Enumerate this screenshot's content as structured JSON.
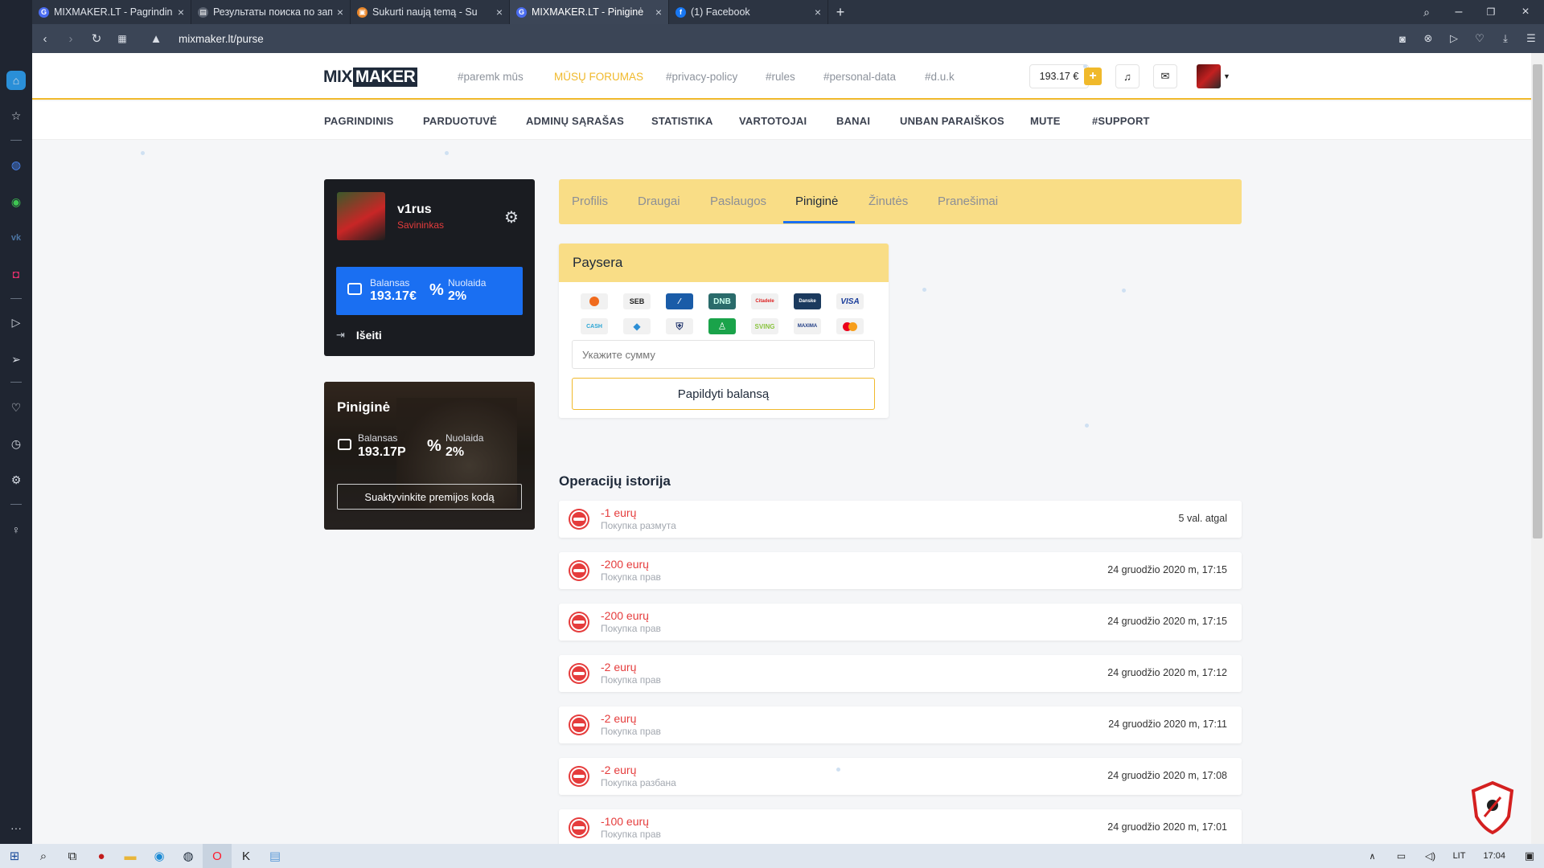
{
  "browser": {
    "tabs": [
      {
        "title": "MIXMAKER.LT - Pagrindinis",
        "favicon": "G",
        "fav_color": "#4a6cf0"
      },
      {
        "title": "Результаты поиска по зап",
        "favicon": "▤",
        "fav_color": "#5a6270"
      },
      {
        "title": "Sukurti naują temą - Su",
        "favicon": "▣",
        "fav_color": "#e8862a"
      },
      {
        "title": "MIXMAKER.LT - Piniginė",
        "favicon": "G",
        "fav_color": "#4a6cf0"
      },
      {
        "title": "(1) Facebook",
        "favicon": "f",
        "fav_color": "#1877f2"
      }
    ],
    "new_tab": "+",
    "address": "mixmaker.lt/purse"
  },
  "site": {
    "logo_mix": "MIX",
    "logo_maker": "MAKER",
    "top_links": [
      "#paremk mūs",
      "MŪSŲ FORUMAS",
      "#privacy-policy",
      "#rules",
      "#personal-data",
      "#d.u.k"
    ],
    "balance_pill": "193.17 €",
    "add_btn": "+",
    "menu": [
      "PAGRINDINIS",
      "PARDUOTUVĖ",
      "ADMINŲ SĄRAŠAS",
      "STATISTIKA",
      "VARTOTOJAI",
      "BANAI",
      "UNBAN PARAIŠKOS",
      "MUTE",
      "#SUPPORT"
    ]
  },
  "profile": {
    "name": "v1rus",
    "role": "Savininkas",
    "balance_label": "Balansas",
    "balance": "193.17€",
    "discount_label": "Nuolaida",
    "discount": "2%",
    "logout": "Išeiti"
  },
  "wallet": {
    "title": "Piniginė",
    "balance_label": "Balansas",
    "balance": "193.17P",
    "discount_label": "Nuolaida",
    "discount": "2%",
    "promo_btn": "Suaktyvinkite premijos kodą"
  },
  "tabs": [
    "Profilis",
    "Draugai",
    "Paslaugos",
    "Piniginė",
    "Žinutės",
    "Pranešimai"
  ],
  "active_tab": "Piniginė",
  "paysera": {
    "title": "Paysera",
    "banks": [
      "SEB",
      "DNB",
      "Citadele",
      "Danske",
      "VISA",
      "CASH",
      "SVING",
      "MAXIMA"
    ],
    "amount_placeholder": "Укажите сумму",
    "submit": "Papildyti balansą"
  },
  "history": {
    "title": "Operacijų istorija",
    "items": [
      {
        "amount": "-1 eurų",
        "desc": "Покупка размута",
        "date": "5 val. atgal"
      },
      {
        "amount": "-200 eurų",
        "desc": "Покупка прав",
        "date": "24 gruodžio 2020 m, 17:15"
      },
      {
        "amount": "-200 eurų",
        "desc": "Покупка прав",
        "date": "24 gruodžio 2020 m, 17:15"
      },
      {
        "amount": "-2 eurų",
        "desc": "Покупка прав",
        "date": "24 gruodžio 2020 m, 17:12"
      },
      {
        "amount": "-2 eurų",
        "desc": "Покупка прав",
        "date": "24 gruodžio 2020 m, 17:11"
      },
      {
        "amount": "-2 eurų",
        "desc": "Покупка разбана",
        "date": "24 gruodžio 2020 m, 17:08"
      },
      {
        "amount": "-100 eurų",
        "desc": "Покупка прав",
        "date": "24 gruodžio 2020 m, 17:01"
      }
    ]
  },
  "taskbar": {
    "lang": "LIT",
    "time": "17:04"
  },
  "colors": {
    "accent": "#f0b92b",
    "blue": "#1a6ff2",
    "red": "#e53c3c",
    "tabs_bg": "#f9dd86"
  }
}
